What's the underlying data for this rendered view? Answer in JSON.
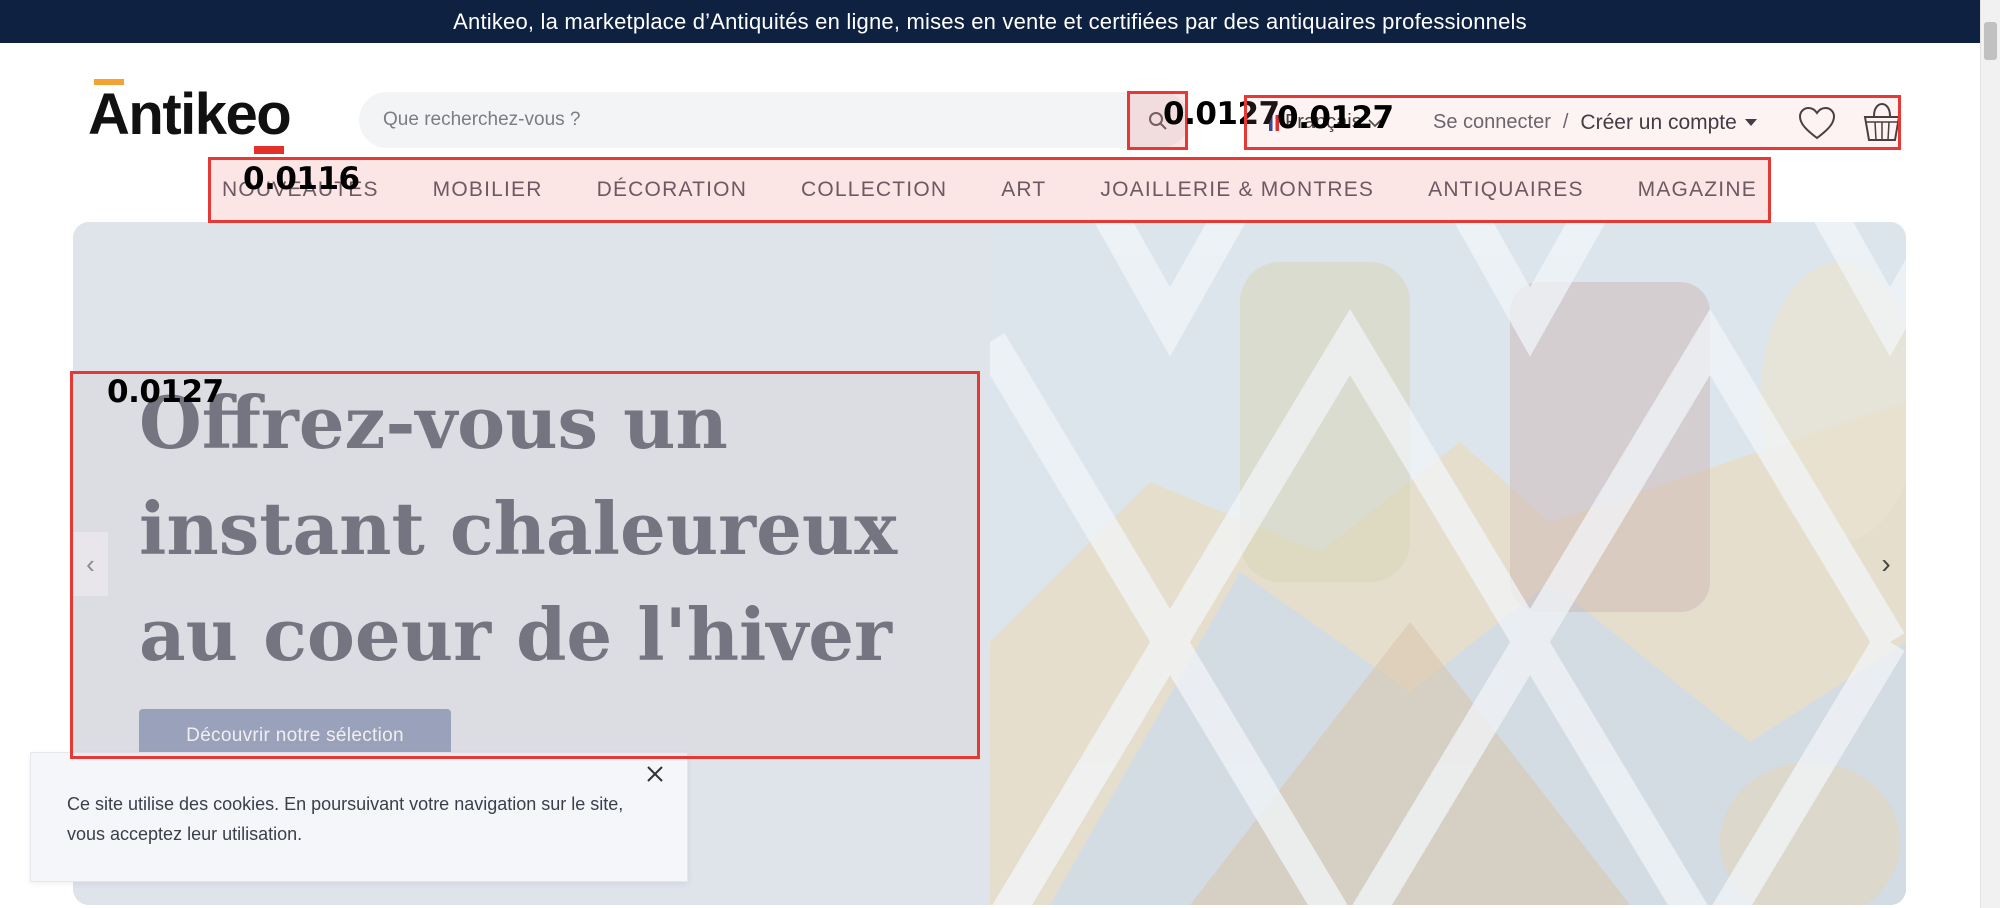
{
  "announcement": "Antikeo, la marketplace d’Antiquités en ligne, mises en vente et certifiées par des antiquaires professionnels",
  "logo": {
    "text": "Antikeo"
  },
  "search": {
    "placeholder": "Que recherchez-vous ?"
  },
  "header": {
    "language": "Français",
    "login": "Se connecter",
    "separator": "/",
    "signup": "Créer un compte"
  },
  "nav": {
    "items": [
      {
        "label": "NOUVEAUTÉS"
      },
      {
        "label": "MOBILIER"
      },
      {
        "label": "DÉCORATION"
      },
      {
        "label": "COLLECTION"
      },
      {
        "label": "ART"
      },
      {
        "label": "JOAILLERIE & MONTRES"
      },
      {
        "label": "ANTIQUAIRES"
      },
      {
        "label": "MAGAZINE"
      }
    ]
  },
  "hero": {
    "title": "Offrez-vous un instant chaleureux au coeur de l'hiver",
    "cta": "Découvrir notre sélection",
    "prev": "‹",
    "next": "›"
  },
  "cookie": {
    "message": "Ce site utilise des cookies. En poursuivant votre navigation sur le site, vous acceptez leur utilisation."
  },
  "overlays": {
    "search_button_score": "0.0127",
    "header_right_score": "0.0127",
    "nav_score": "0.0116",
    "hero_text_score": "0.0127"
  },
  "colors": {
    "topbar": "#0f2140",
    "accent_orange": "#f3a233",
    "accent_red": "#e0312b",
    "cta": "#7a8aac",
    "overlay_border": "#e53935"
  }
}
